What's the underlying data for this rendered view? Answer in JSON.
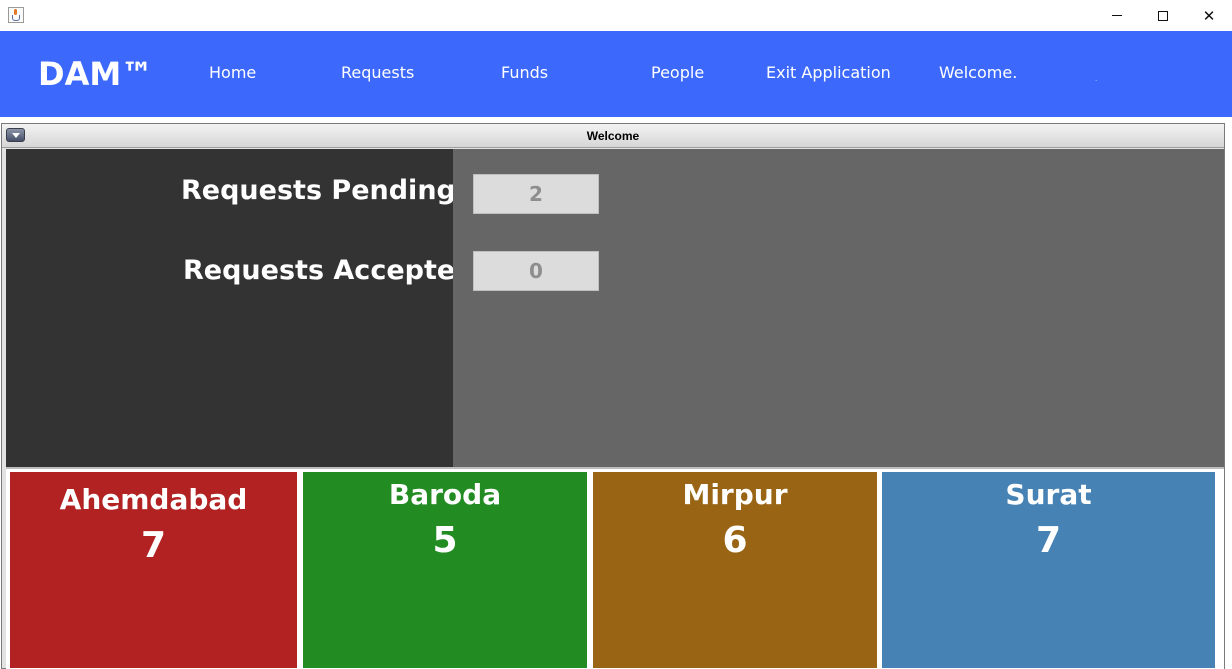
{
  "window": {
    "icon": "java-cup-icon",
    "controls": {
      "minimize": "minimize-icon",
      "maximize": "maximize-icon",
      "close": "close-icon",
      "close_glyph": "✕"
    }
  },
  "navbar": {
    "brand": "DAM™",
    "links": [
      "Home",
      "Requests",
      "Funds",
      "People",
      "Exit Application",
      "Welcome."
    ],
    "trailing": ".",
    "color": "#3c69fb"
  },
  "frame": {
    "title": "Welcome"
  },
  "stats": {
    "pending_label": "Requests Pending",
    "pending_value": "2",
    "accepted_label": "Requests Accepted",
    "accepted_value": "0"
  },
  "cities": [
    {
      "name": "Ahemdabad",
      "count": "7",
      "color": "#b22222"
    },
    {
      "name": "Baroda",
      "count": "5",
      "color": "#228b22"
    },
    {
      "name": "Mirpur",
      "count": "6",
      "color": "#996515"
    },
    {
      "name": "Surat",
      "count": "7",
      "color": "#4682b4"
    }
  ]
}
